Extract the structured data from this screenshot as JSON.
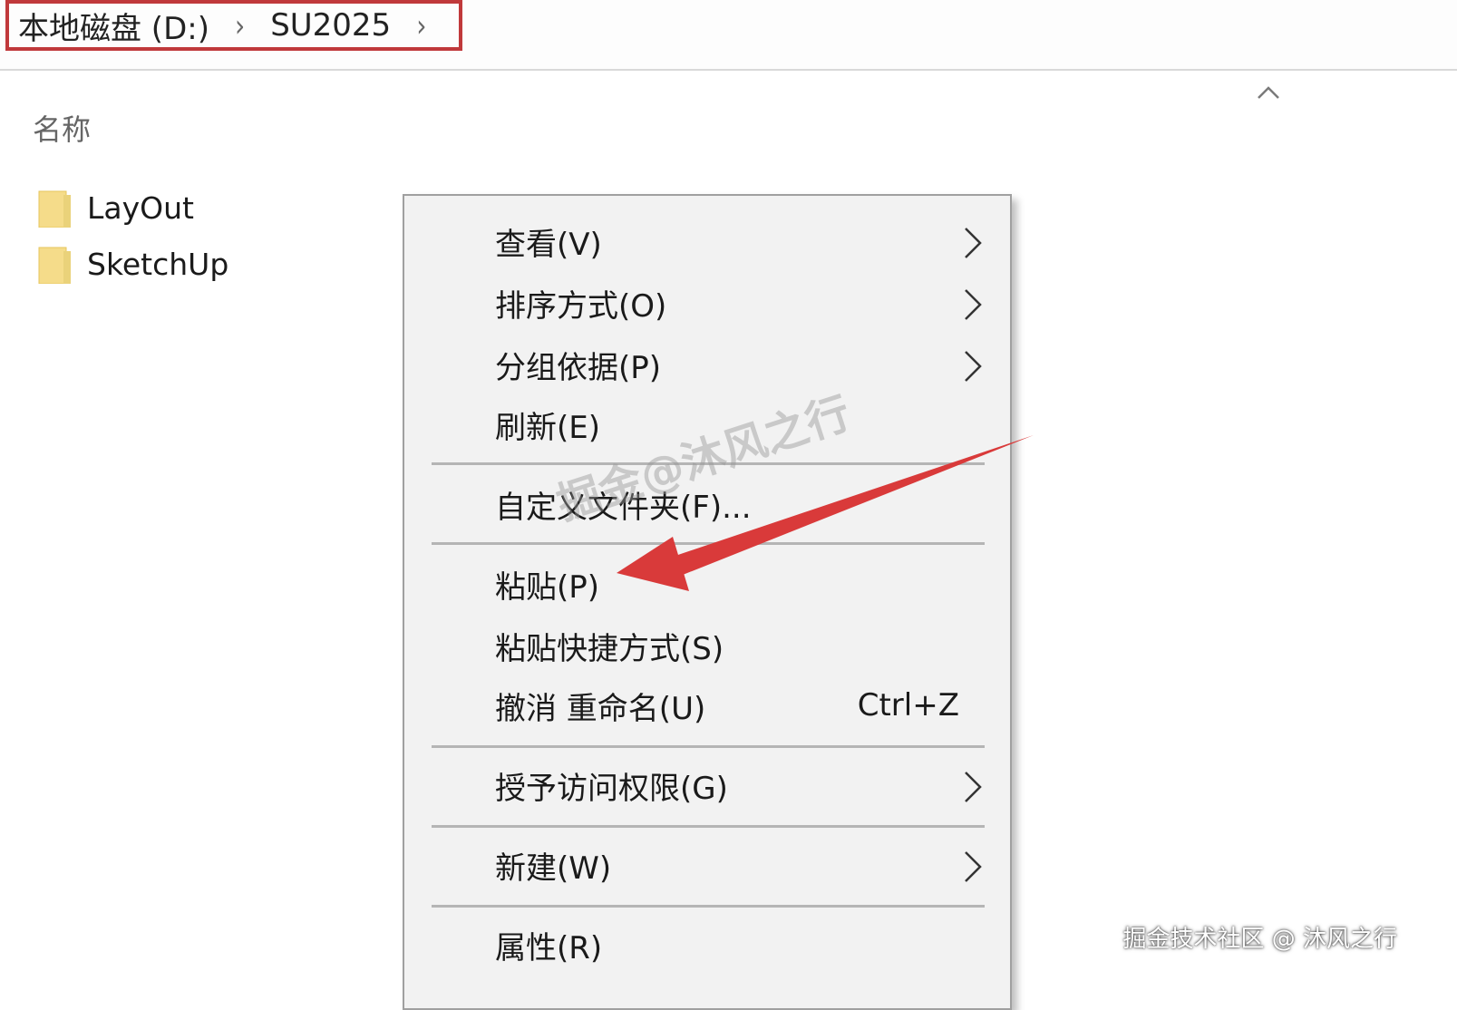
{
  "breadcrumb": {
    "items": [
      "本地磁盘 (D:)",
      "SU2025"
    ],
    "separator": "›",
    "highlight_color": "#c0393b"
  },
  "file_list": {
    "column_header": "名称",
    "items": [
      {
        "name": "LayOut",
        "icon": "folder-icon"
      },
      {
        "name": "SketchUp",
        "icon": "folder-icon"
      }
    ]
  },
  "context_menu": {
    "items": [
      {
        "label": "查看(V)",
        "has_submenu": true
      },
      {
        "label": "排序方式(O)",
        "has_submenu": true
      },
      {
        "label": "分组依据(P)",
        "has_submenu": true
      },
      {
        "label": "刷新(E)",
        "has_submenu": false
      },
      {
        "label": "自定义文件夹(F)...",
        "has_submenu": false
      },
      {
        "label": "粘贴(P)",
        "has_submenu": false,
        "highlighted_by_annotation": true
      },
      {
        "label": "粘贴快捷方式(S)",
        "has_submenu": false
      },
      {
        "label": "撤消 重命名(U)",
        "shortcut": "Ctrl+Z",
        "has_submenu": false
      },
      {
        "label": "授予访问权限(G)",
        "has_submenu": true
      },
      {
        "label": "新建(W)",
        "has_submenu": true
      },
      {
        "label": "属性(R)",
        "has_submenu": false
      }
    ]
  },
  "annotation": {
    "type": "arrow",
    "color": "#d93a3a"
  },
  "watermarks": {
    "center": "掘金@沐风之行",
    "corner": "掘金技术社区 @ 沐风之行"
  }
}
